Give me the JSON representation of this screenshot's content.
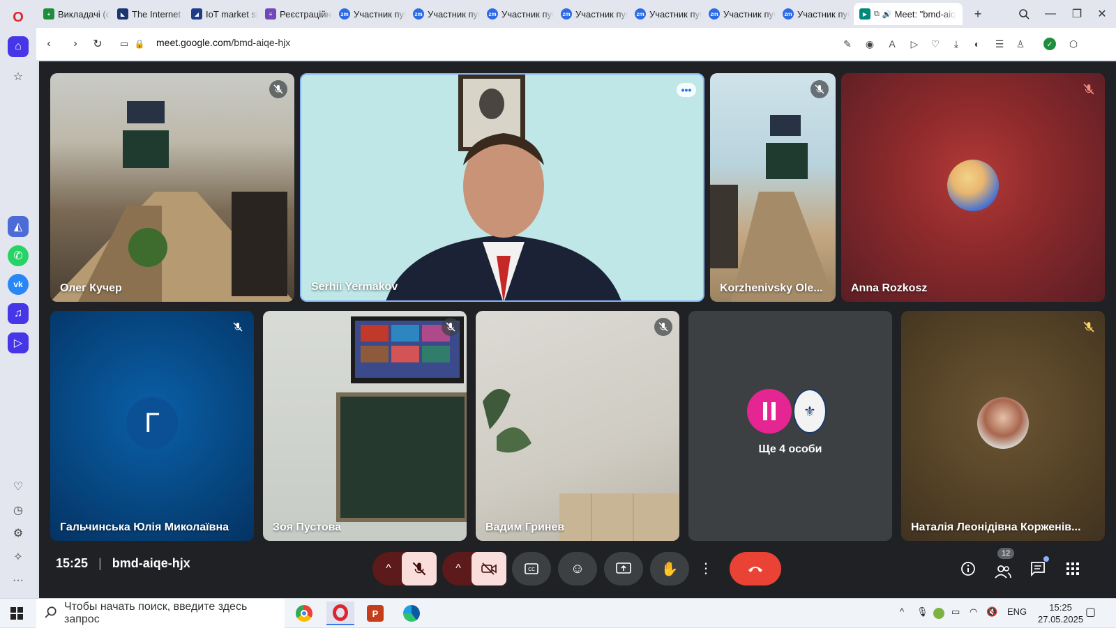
{
  "browser": {
    "tabs": [
      {
        "label": "Викладачі (он",
        "icon_color": "#1e8e3e",
        "icon": "plus-icon"
      },
      {
        "label": "The Internet c",
        "icon_color": "#1a3570",
        "icon": "site-icon"
      },
      {
        "label": "IoT market si",
        "icon_color": "#1f3c88",
        "icon": "site-icon"
      },
      {
        "label": "Реєстраційна",
        "icon_color": "#7248b9",
        "icon": "form-icon"
      },
      {
        "label": "Участник пуб",
        "icon_color": "#2d6be4",
        "icon": "zm"
      },
      {
        "label": "Участник пуб",
        "icon_color": "#2d6be4",
        "icon": "zm"
      },
      {
        "label": "Участник пуб",
        "icon_color": "#2d6be4",
        "icon": "zm"
      },
      {
        "label": "Участник пуб",
        "icon_color": "#2d6be4",
        "icon": "zm"
      },
      {
        "label": "Участник пуб",
        "icon_color": "#2d6be4",
        "icon": "zm"
      },
      {
        "label": "Участник пуб",
        "icon_color": "#2d6be4",
        "icon": "zm"
      },
      {
        "label": "Участник пуб",
        "icon_color": "#2d6be4",
        "icon": "zm"
      },
      {
        "label": "Meet: \"bmd-aiq",
        "icon_color": "#00897b",
        "icon": "meet-icon",
        "active": true
      }
    ],
    "zm_text": "zm",
    "url_host": "meet.google.com",
    "url_path": "/bmd-aiqe-hjx"
  },
  "meeting": {
    "tiles_row1": [
      {
        "name": "Олег Кучер"
      },
      {
        "name": "Serhii Yermakov"
      },
      {
        "name": "Korzhenivsky Ole..."
      },
      {
        "name": "Anna Rozkosz"
      }
    ],
    "tiles_row2": [
      {
        "name": "Гальчинська Юлія Миколаївна",
        "initial": "Г"
      },
      {
        "name": "Зоя Пустова"
      },
      {
        "name": "Вадим Гринев"
      },
      {
        "name": "Ще 4 особи"
      },
      {
        "name": "Наталія Леонідівна Корженів..."
      }
    ],
    "time": "15:25",
    "code": "bmd-aiqe-hjx",
    "participants_count": "12"
  },
  "taskbar": {
    "search_placeholder": "Чтобы начать поиск, введите здесь запрос",
    "lang": "ENG",
    "time": "15:25",
    "date": "27.05.2025"
  },
  "colors": {
    "meet_bg": "#202124",
    "end_call": "#ea4335",
    "muted_red": "#f9dedc",
    "accent": "#1a73e8"
  }
}
